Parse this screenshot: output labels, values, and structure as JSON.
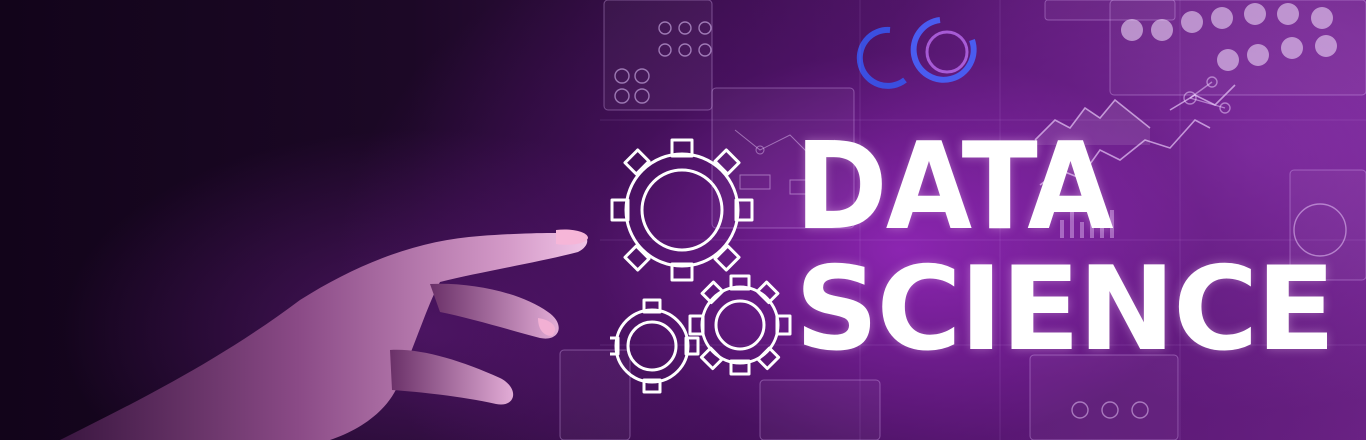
{
  "headline": {
    "line_1": "DATA",
    "line_2": "SCIENCE"
  },
  "icons": {
    "gears": "gears-icon",
    "hand": "pointing-hand",
    "panels": "holographic-panel-icons"
  },
  "colors": {
    "background_dark": "#140618",
    "glow_purple": "#9b2bc4",
    "text": "#ffffff",
    "accent_blue": "#3b4fe0"
  }
}
